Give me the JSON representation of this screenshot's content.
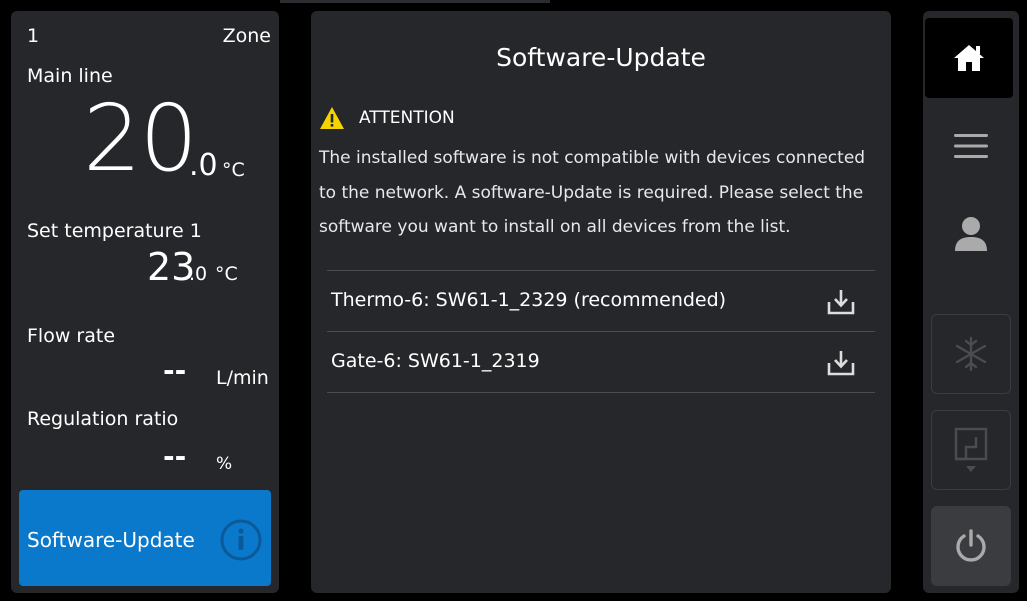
{
  "left_panel": {
    "zone_number": "1",
    "zone_label": "Zone",
    "main_line_label": "Main line",
    "main_temp_int": "20",
    "main_temp_dec": ".0",
    "main_temp_unit": "°C",
    "set_temp_label": "Set temperature 1",
    "set_temp_int": "23",
    "set_temp_dec": ".0",
    "set_temp_unit": "°C",
    "flow_rate_label": "Flow rate",
    "flow_rate_value": "--",
    "flow_rate_unit": "L/min",
    "regulation_label": "Regulation ratio",
    "regulation_value": "--",
    "regulation_unit": "%",
    "software_button_label": "Software-Update",
    "software_button_icon": "info-icon"
  },
  "dialog": {
    "title": "Software-Update",
    "attention_label": "ATTENTION",
    "attention_icon": "warning-icon",
    "message": "The installed software is not compatible with devices connected to the network. A software-Update is required. Please select the software you want to install on all devices from the list.",
    "software_items": [
      {
        "label": "Thermo-6: SW61-1_2329 (recommended)",
        "icon": "download-icon"
      },
      {
        "label": "Gate-6: SW61-1_2319",
        "icon": "download-icon"
      }
    ]
  },
  "rail": {
    "items": [
      "home-icon",
      "menu-icon",
      "user-icon",
      "snowflake-icon",
      "door-icon",
      "power-icon"
    ]
  },
  "colors": {
    "panel_bg": "#25272b",
    "accent_blue": "#0a79cc",
    "warning_yellow": "#f5d400",
    "divider": "#4a4c50"
  }
}
